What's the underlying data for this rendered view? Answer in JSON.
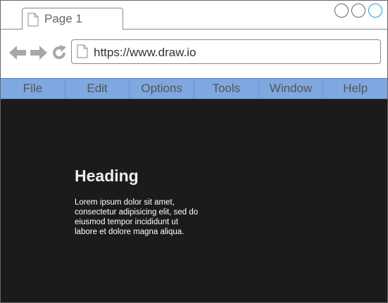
{
  "browser": {
    "tab": {
      "label": "Page 1",
      "icon": "document-icon"
    },
    "window_controls": [
      "circle",
      "circle",
      "circle"
    ],
    "window_control_accent": "#1ba1e2",
    "nav": {
      "back_icon": "back-arrow-icon",
      "forward_icon": "forward-arrow-icon",
      "reload_icon": "reload-icon"
    },
    "address_bar": {
      "url": "https://www.draw.io",
      "icon": "document-icon"
    }
  },
  "menu": {
    "items": [
      "File",
      "Edit",
      "Options",
      "Tools",
      "Window",
      "Help"
    ],
    "background": "#7fa7e0"
  },
  "content": {
    "background": "#1b1b1b",
    "heading": "Heading",
    "body": "Lorem ipsum dolor sit amet, consectetur adipisicing elit, sed do eiusmod tempor incididunt ut labore et dolore magna aliqua."
  }
}
